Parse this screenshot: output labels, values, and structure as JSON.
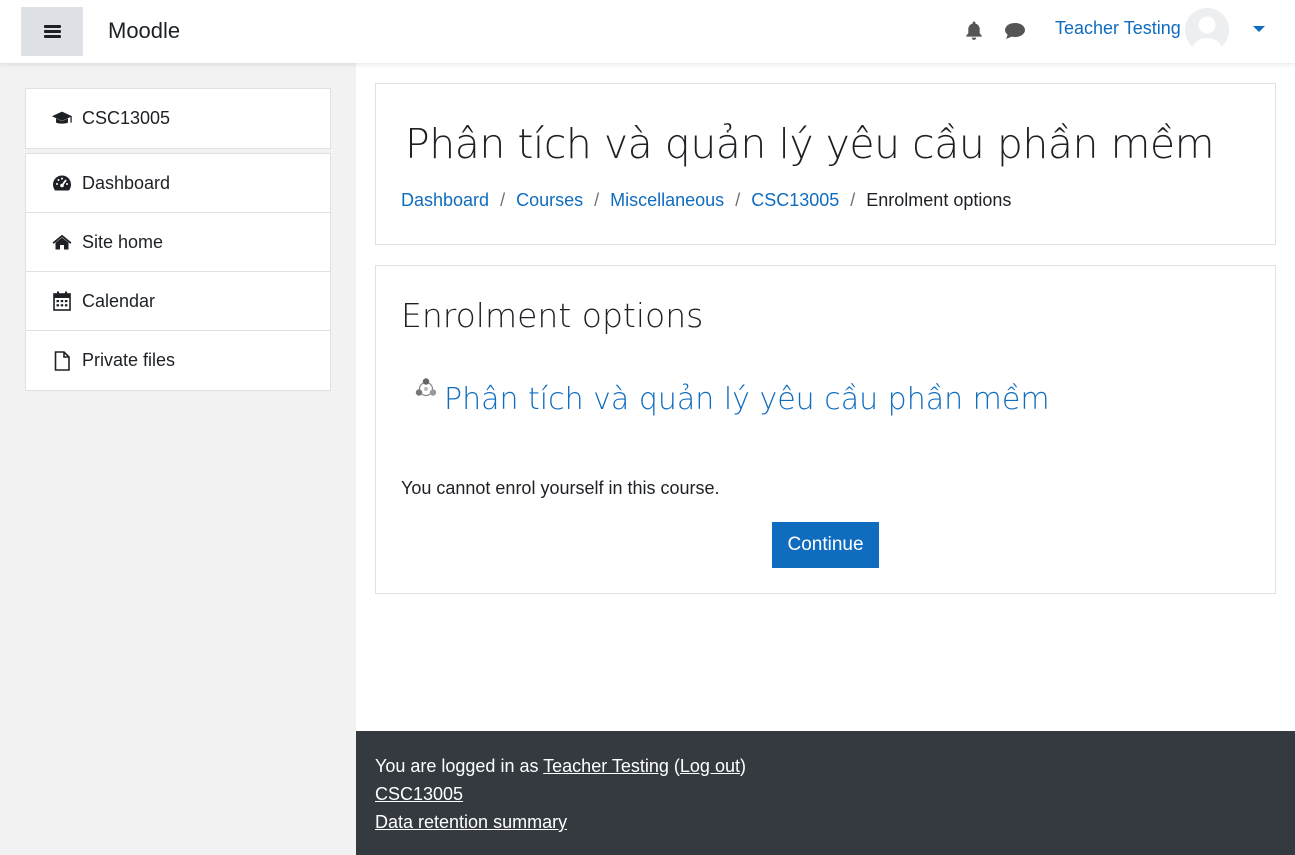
{
  "navbar": {
    "brand": "Moodle",
    "user_name": "Teacher Testing",
    "icons": [
      "menu-icon",
      "bell-icon",
      "chat-icon",
      "avatar",
      "caret-down-icon"
    ]
  },
  "sidebar": {
    "course": {
      "label": "CSC13005",
      "icon": "graduation-cap-icon"
    },
    "items": [
      {
        "label": "Dashboard",
        "icon": "tachometer-icon"
      },
      {
        "label": "Site home",
        "icon": "home-icon"
      },
      {
        "label": "Calendar",
        "icon": "calendar-icon"
      },
      {
        "label": "Private files",
        "icon": "file-icon"
      }
    ]
  },
  "header": {
    "title": "Phân tích và quản lý yêu cầu phần mềm",
    "breadcrumb": [
      "Dashboard",
      "Courses",
      "Miscellaneous",
      "CSC13005",
      "Enrolment options"
    ],
    "separator": "/"
  },
  "main": {
    "section_title": "Enrolment options",
    "course_name": "Phân tích và quản lý yêu cầu phần mềm",
    "notice": "You cannot enrol yourself in this course.",
    "continue_label": "Continue"
  },
  "footer": {
    "logged_in_prefix": "You are logged in as ",
    "user_link": "Teacher Testing",
    "open_paren": " (",
    "logout": "Log out",
    "close_paren": ")",
    "course_link": "CSC13005",
    "data_retention": "Data retention summary"
  },
  "colors": {
    "accent": "#0f6cbf",
    "footer_bg": "#343a40",
    "sidebar_bg": "#f2f2f2",
    "menu_button_bg": "#dee2e6"
  }
}
